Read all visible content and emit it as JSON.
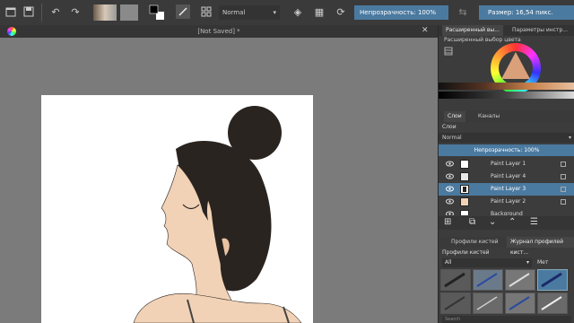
{
  "toolbar": {
    "blend_mode": "Normal",
    "opacity_label": "Непрозрачность: 100%",
    "size_label": "Размер: 16,54 пикс."
  },
  "document": {
    "title": "[Not Saved]",
    "title_suffix": "*"
  },
  "dock": {
    "top_tabs": [
      "Расширенный вы...",
      "Параметры инстр..."
    ],
    "color_selector_title": "Расширенный выбор цвета",
    "layers_tabs": [
      "Слои",
      "Каналы"
    ],
    "layers_heading": "Слои",
    "blend_mode": "Normal",
    "opacity_label": "Непрозрачность:  100%",
    "layers": [
      {
        "name": "Paint Layer 1",
        "selected": false
      },
      {
        "name": "Paint Layer 4",
        "selected": false
      },
      {
        "name": "Paint Layer 3",
        "selected": true
      },
      {
        "name": "Paint Layer 2",
        "selected": false
      },
      {
        "name": "Background",
        "selected": false
      }
    ],
    "brush_tabs": [
      "Профили кистей",
      "Журнал профилей кист..."
    ],
    "brush_heading": "Профили кистей",
    "brush_filter": "All",
    "brush_tag_label": "Мет",
    "search_placeholder": "Search"
  },
  "colors": {
    "accent": "#4b7aa0",
    "canvas_bg": "#7b7b7b",
    "panel_bg": "#3c3c3c",
    "skin": "#f2d2b6",
    "hair": "#2a2420"
  }
}
